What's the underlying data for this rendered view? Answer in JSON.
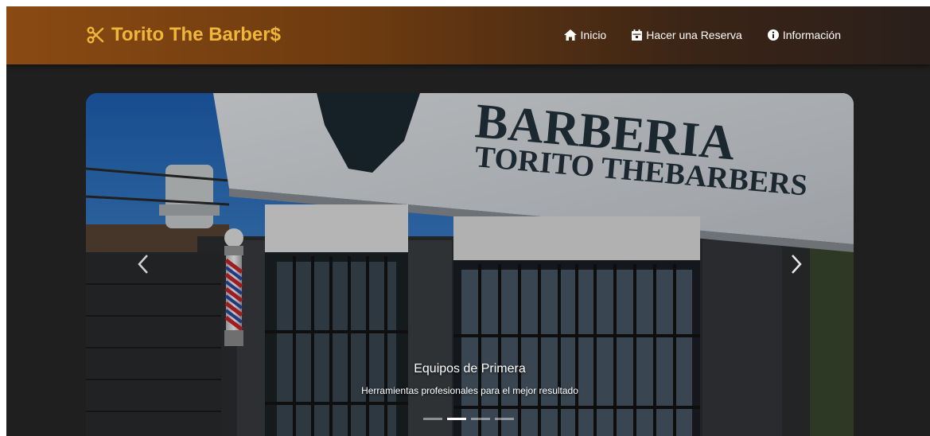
{
  "navbar": {
    "brand": "Torito The Barber$",
    "brand_icon": "scissors-icon",
    "links": [
      {
        "label": "Inicio",
        "icon": "home-icon"
      },
      {
        "label": "Hacer una Reserva",
        "icon": "calendar-icon"
      },
      {
        "label": "Información",
        "icon": "info-icon"
      }
    ]
  },
  "carousel": {
    "slide": {
      "sign_line1": "BARBERIA",
      "sign_line2": "TORITO THEBARBERS",
      "caption_title": "Equipos de Primera",
      "caption_text": "Herramientas profesionales para el mejor resultado"
    },
    "active_index": 1,
    "indicator_count": 4
  },
  "colors": {
    "brand": "#f0b63a",
    "nav_gradient_start": "#8a4a12",
    "background": "#1f1f1f"
  }
}
